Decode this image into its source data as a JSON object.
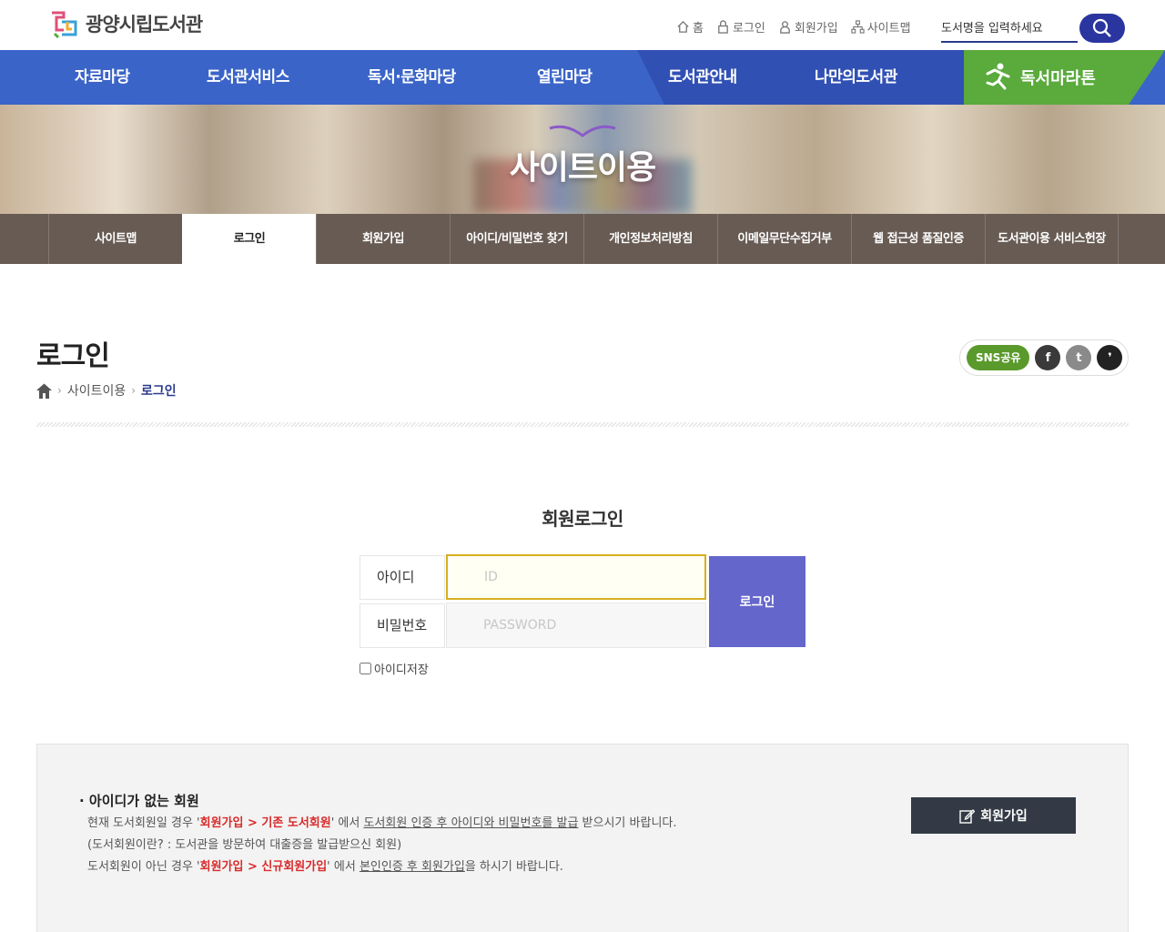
{
  "header": {
    "logo_text": "광양시립도서관",
    "util": [
      {
        "label": "홈",
        "icon": "home-icon"
      },
      {
        "label": "로그인",
        "icon": "lock-icon"
      },
      {
        "label": "회원가입",
        "icon": "user-icon"
      },
      {
        "label": "사이트맵",
        "icon": "sitemap-icon"
      }
    ],
    "search_placeholder": "도서명을 입력하세요"
  },
  "gnb": {
    "items": [
      "자료마당",
      "도서관서비스",
      "독서·문화마당",
      "열린마당",
      "도서관안내",
      "나만의도서관"
    ],
    "marathon": "독서마라톤"
  },
  "visual": {
    "title": "사이트이용"
  },
  "subtabs": [
    "사이트맵",
    "로그인",
    "회원가입",
    "아이디/비밀번호 찾기",
    "개인정보처리방침",
    "이메일무단수집거부",
    "웹 접근성 품질인증",
    "도서관이용 서비스헌장"
  ],
  "active_subtab": "로그인",
  "page": {
    "title": "로그인",
    "breadcrumb": [
      "사이트이용",
      "로그인"
    ],
    "sns_label": "SNS공유",
    "sns": [
      {
        "icon": "facebook-icon",
        "glyph": "f",
        "color": "#3a3a3a"
      },
      {
        "icon": "twitter-icon",
        "glyph": "t",
        "color": "#8a8a8a"
      },
      {
        "icon": "kakaostory-icon",
        "glyph": "❜",
        "color": "#222222"
      }
    ]
  },
  "login": {
    "title": "회원로그인",
    "id_label": "아이디",
    "id_placeholder": "ID",
    "pw_label": "비밀번호",
    "pw_placeholder": "PASSWORD",
    "button": "로그인",
    "save_id": "아이디저장"
  },
  "info": {
    "heading": "· 아이디가 없는 회원",
    "line1_a": "현재 도서회원일 경우 '",
    "line1_red": "회원가입 > 기존 도서회원",
    "line1_b": "' 에서 ",
    "line1_u": "도서회원 인증 후 아이디와 비밀번호를 발급",
    "line1_c": " 받으시기 바랍니다.",
    "line2": "(도서회원이란? : 도서관을 방문하여 대출증을 발급받으신 회원)",
    "line3_a": "도서회원이 아닌 경우 '",
    "line3_red": "회원가입 > 신규회원가입",
    "line3_b": "' 에서 ",
    "line3_u": "본인인증 후 회원가입",
    "line3_c": "을 하시기 바랍니다.",
    "join_button": "회원가입"
  },
  "colors": {
    "gnb": "#3a64c8",
    "marathon": "#5aaa3c",
    "login_button": "#6466cc",
    "accent_red": "#d92a2a"
  }
}
